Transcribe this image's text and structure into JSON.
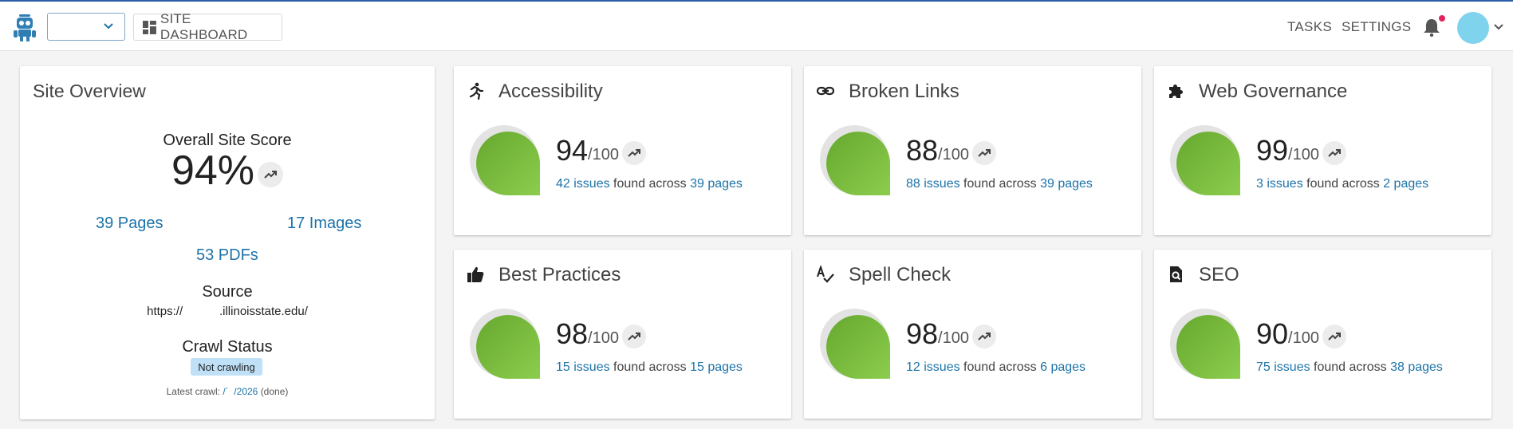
{
  "topbar": {
    "site_select_value": "",
    "dashboard_label": "SITE DASHBOARD",
    "nav": [
      "TASKS",
      "SETTINGS"
    ],
    "colors": {
      "accent": "#2a5ea8",
      "notification_dot": "#e0245e",
      "avatar": "#7fd3ec"
    }
  },
  "overview": {
    "title": "Site Overview",
    "score_label": "Overall Site Score",
    "score": "94%",
    "pages": "39 Pages",
    "images": "17 Images",
    "pdfs": "53 PDFs",
    "source_label": "Source",
    "source_url": "https://           .illinoisstate.edu/",
    "crawl_label": "Crawl Status",
    "crawl_status": "Not crawling",
    "latest_label": "Latest crawl:",
    "latest_date": "/´  /2026",
    "latest_state": "(done)"
  },
  "metrics": [
    {
      "title": "Accessibility",
      "icon": "person-running-icon",
      "score": "94",
      "max": "/100",
      "issues": "42 issues",
      "mid": " found across ",
      "pages": "39 pages"
    },
    {
      "title": "Broken Links",
      "icon": "link-icon",
      "score": "88",
      "max": "/100",
      "issues": "88 issues",
      "mid": " found across ",
      "pages": "39 pages"
    },
    {
      "title": "Web Governance",
      "icon": "puzzle-icon",
      "score": "99",
      "max": "/100",
      "issues": "3 issues",
      "mid": " found across ",
      "pages": "2 pages"
    },
    {
      "title": "Best Practices",
      "icon": "thumbs-up-icon",
      "score": "98",
      "max": "/100",
      "issues": "15 issues",
      "mid": " found across ",
      "pages": "15 pages"
    },
    {
      "title": "Spell Check",
      "icon": "spellcheck-icon",
      "score": "98",
      "max": "/100",
      "issues": "12 issues",
      "mid": " found across ",
      "pages": "6 pages"
    },
    {
      "title": "SEO",
      "icon": "search-document-icon",
      "score": "90",
      "max": "/100",
      "issues": "75 issues",
      "mid": " found across ",
      "pages": "38 pages"
    }
  ]
}
